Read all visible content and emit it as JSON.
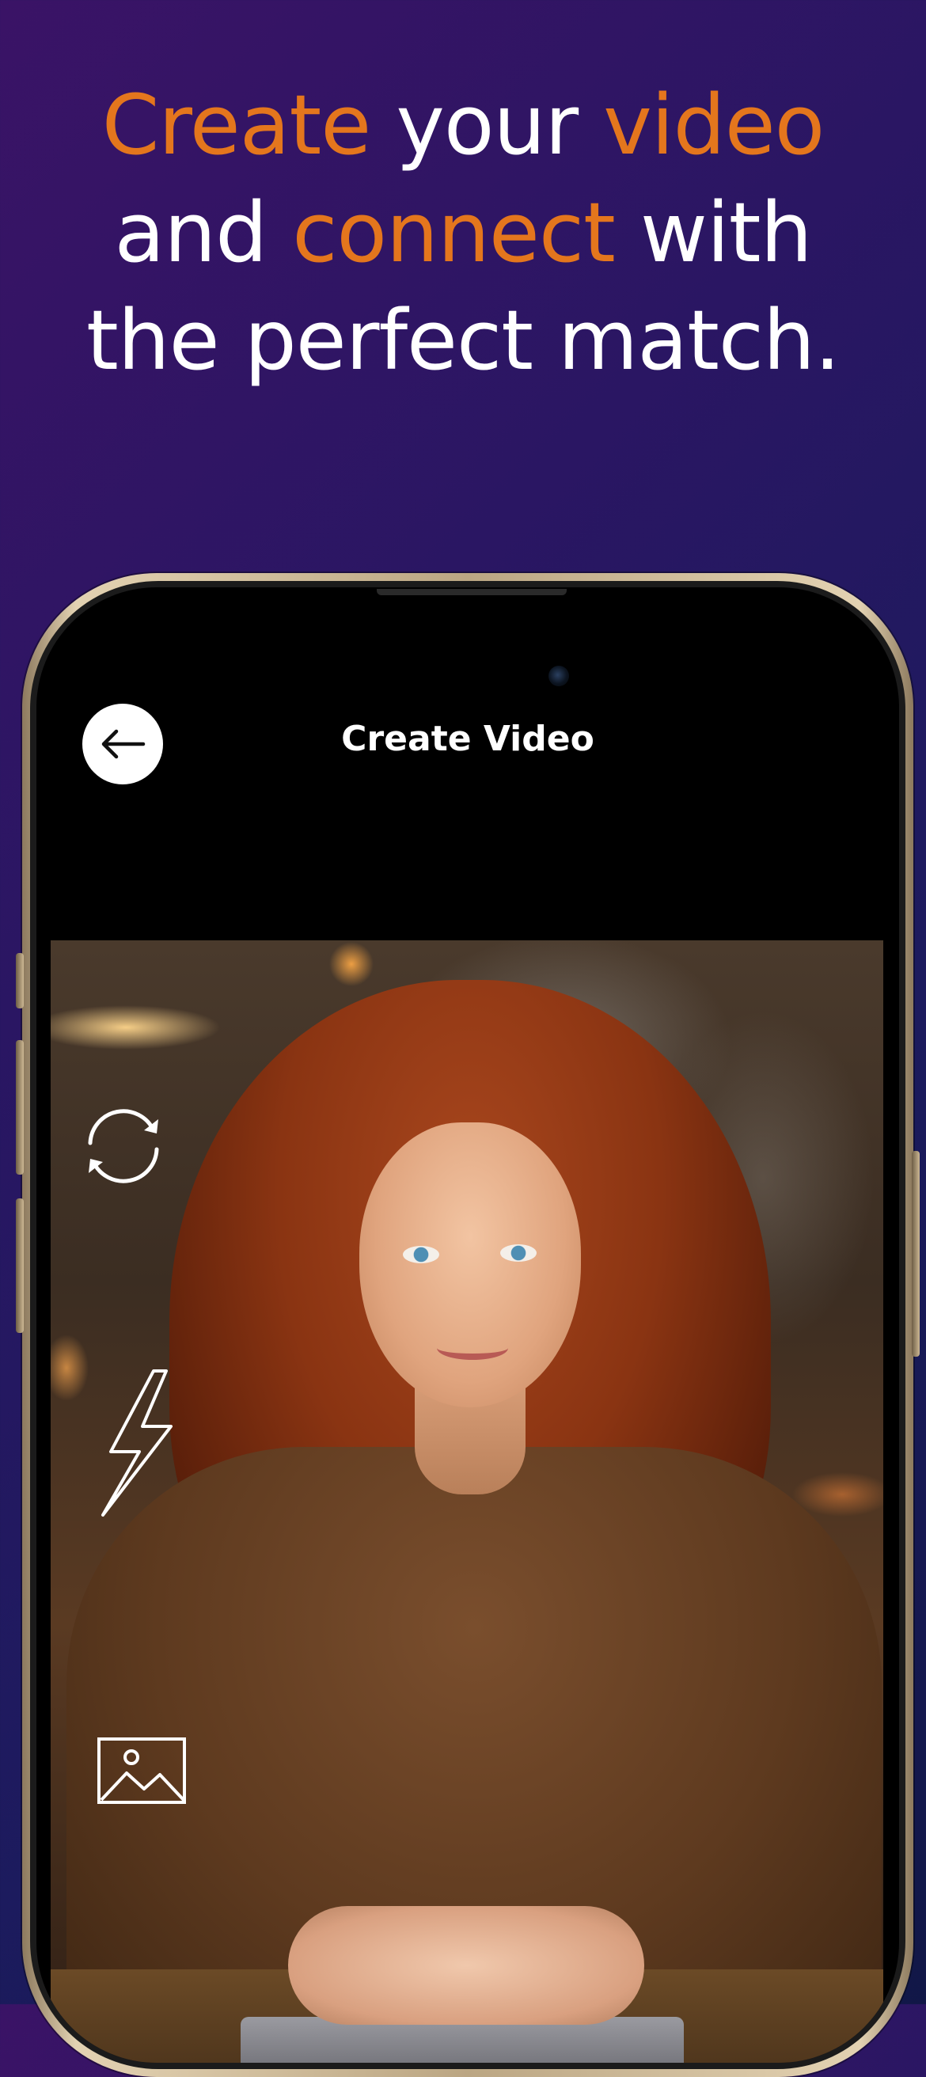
{
  "headline": {
    "line1": [
      {
        "text": "Create",
        "style": "accent"
      },
      {
        "text": " your ",
        "style": "white"
      },
      {
        "text": "video",
        "style": "accent"
      }
    ],
    "line2": [
      {
        "text": "and ",
        "style": "white"
      },
      {
        "text": "connect",
        "style": "accent"
      },
      {
        "text": " with",
        "style": "white"
      }
    ],
    "line3": [
      {
        "text": "the perfect match.",
        "style": "white"
      }
    ]
  },
  "screen": {
    "title": "Create Video",
    "back_icon": "arrow-left-icon",
    "tools": [
      {
        "name": "switch-camera",
        "icon": "rotate-camera-icon"
      },
      {
        "name": "flash",
        "icon": "lightning-icon"
      },
      {
        "name": "gallery",
        "icon": "image-icon"
      }
    ]
  },
  "colors": {
    "accent": "#e4761d",
    "text": "#ffffff",
    "background_start": "#3a1366",
    "background_end": "#111747"
  }
}
